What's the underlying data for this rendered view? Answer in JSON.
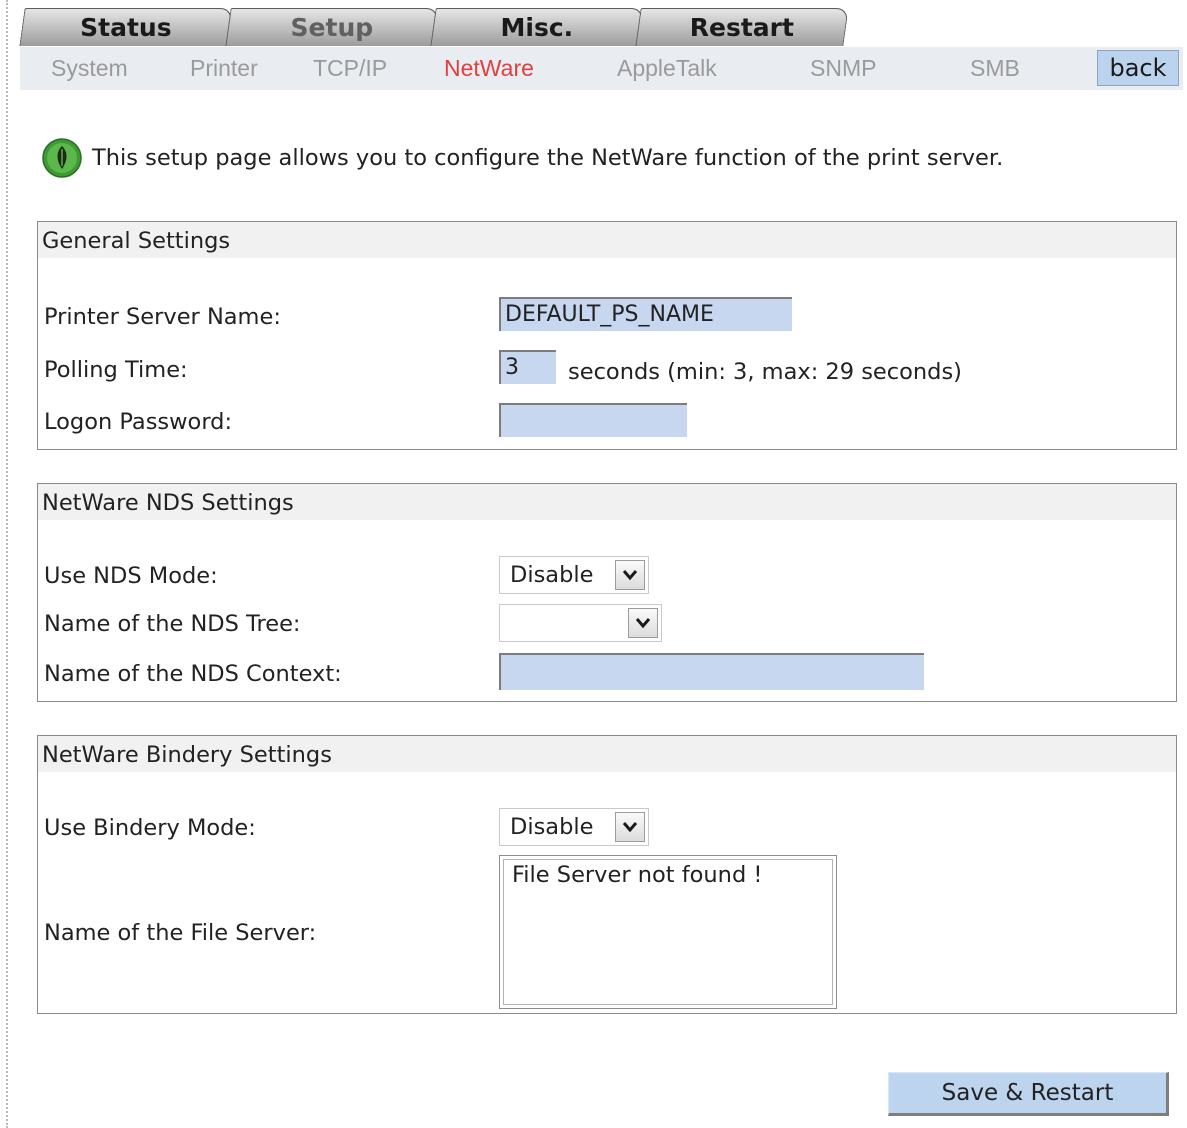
{
  "main_tabs": [
    {
      "label": "Status"
    },
    {
      "label": "Setup"
    },
    {
      "label": "Misc."
    },
    {
      "label": "Restart"
    }
  ],
  "active_main_tab": "Setup",
  "sub_nav": {
    "items": [
      {
        "label": "System"
      },
      {
        "label": "Printer"
      },
      {
        "label": "TCP/IP"
      },
      {
        "label": "NetWare"
      },
      {
        "label": "AppleTalk"
      },
      {
        "label": "SNMP"
      },
      {
        "label": "SMB"
      }
    ],
    "active": "NetWare",
    "back_label": "back"
  },
  "intro": {
    "icon": "info-leaf-icon",
    "text": "This setup page allows you to configure the NetWare function of the print server."
  },
  "general": {
    "title": "General Settings",
    "ps_name_label": "Printer Server Name:",
    "ps_name_value": "DEFAULT_PS_NAME",
    "polling_label": "Polling Time:",
    "polling_value": "3",
    "polling_suffix": "seconds (min: 3, max: 29 seconds)",
    "password_label": "Logon Password:",
    "password_value": ""
  },
  "nds": {
    "title": "NetWare NDS Settings",
    "mode_label": "Use NDS Mode:",
    "mode_value": "Disable",
    "tree_label": "Name of the NDS Tree:",
    "tree_value": "",
    "context_label": "Name of the NDS Context:",
    "context_value": ""
  },
  "bindery": {
    "title": "NetWare Bindery Settings",
    "mode_label": "Use Bindery Mode:",
    "mode_value": "Disable",
    "file_server_label": "Name of the File Server:",
    "file_server_value": "File Server not found !"
  },
  "save_label": "Save & Restart",
  "colors": {
    "input_bg": "#c6d7ef",
    "active_sub_nav": "#e04040",
    "sub_nav_bg": "#e9edf2",
    "button_bg": "#bdd4ef"
  }
}
